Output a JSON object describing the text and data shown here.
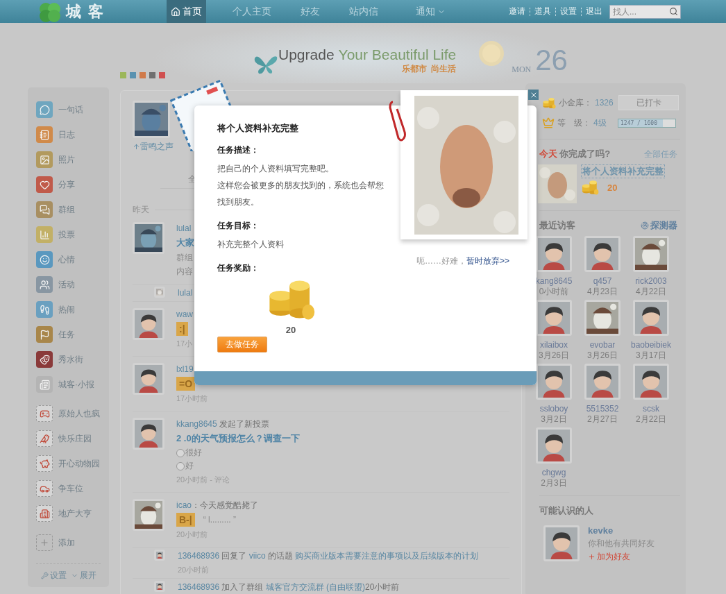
{
  "nav": {
    "logo": "城客",
    "tabs": [
      {
        "label": "首页",
        "kind": "home",
        "selected": true
      },
      {
        "label": "个人主页",
        "kind": "link",
        "selected": false
      },
      {
        "label": "好友",
        "kind": "link",
        "selected": false
      },
      {
        "label": "站内信",
        "kind": "link",
        "selected": false
      },
      {
        "label": "通知",
        "kind": "menu",
        "selected": false
      }
    ],
    "links": [
      "邀请",
      "道具",
      "设置",
      "退出"
    ],
    "search": {
      "placeholder": "找人..."
    }
  },
  "banner": {
    "word": "Upgrade",
    "slogan": "Your Beautiful Life",
    "tagline": "乐都市  尚生活",
    "weekday": "MON",
    "day": "26",
    "skins": [
      {
        "color": "#9cb75a"
      },
      {
        "color": "#5a92b0"
      },
      {
        "color": "#d07a4a"
      },
      {
        "color": "#6f6f6f"
      },
      {
        "color": "#d05050"
      }
    ]
  },
  "sidebar": {
    "items": [
      {
        "label": "一句话",
        "kind": "app"
      },
      {
        "label": "日志",
        "kind": "app"
      },
      {
        "label": "照片",
        "kind": "app"
      },
      {
        "label": "分享",
        "kind": "app"
      },
      {
        "label": "群组",
        "kind": "app"
      },
      {
        "label": "投票",
        "kind": "app"
      },
      {
        "label": "心情",
        "kind": "app"
      },
      {
        "label": "活动",
        "kind": "app"
      },
      {
        "label": "热闹",
        "kind": "app"
      },
      {
        "label": "任务",
        "kind": "app"
      },
      {
        "label": "秀水街",
        "kind": "app"
      },
      {
        "label": "城客·小报",
        "kind": "app"
      },
      {
        "label": "原始人也疯",
        "kind": "game"
      },
      {
        "label": "快乐庄园",
        "kind": "game"
      },
      {
        "label": "开心动物园",
        "kind": "game"
      },
      {
        "label": "争车位",
        "kind": "game"
      },
      {
        "label": "地产大亨",
        "kind": "game"
      },
      {
        "label": "添加",
        "kind": "add"
      }
    ],
    "settings": "设置",
    "expand": "展开"
  },
  "profile": {
    "name": "雷鸣之声"
  },
  "feed": {
    "tab": "全",
    "day": "昨天",
    "items": [
      {
        "kind": "post",
        "photo": true,
        "lines": [
          {
            "kind": "parts",
            "parts": [
              {
                "text": "lulal",
                "link": true
              }
            ]
          },
          {
            "kind": "title",
            "text": "大家"
          },
          {
            "kind": "text",
            "text": "群组"
          },
          {
            "kind": "text",
            "text": "内容"
          }
        ]
      },
      {
        "kind": "activity",
        "photo": true,
        "lines": [
          {
            "kind": "parts",
            "parts": [
              {
                "text": "lulal",
                "link": true
              }
            ]
          }
        ]
      },
      {
        "kind": "post",
        "photo": false,
        "lines": [
          {
            "kind": "parts",
            "parts": [
              {
                "text": "waw",
                "link": true
              }
            ]
          },
          {
            "kind": "mood",
            "badge": ":|"
          },
          {
            "kind": "meta",
            "text": "17小"
          }
        ]
      },
      {
        "kind": "post",
        "photo": false,
        "lines": [
          {
            "kind": "parts",
            "parts": [
              {
                "text": "lxl19",
                "link": true
              }
            ]
          },
          {
            "kind": "mood",
            "badge": "=O"
          },
          {
            "kind": "meta",
            "text": "17小时前"
          }
        ]
      },
      {
        "kind": "post",
        "photo": false,
        "lines": [
          {
            "kind": "parts",
            "parts": [
              {
                "text": "kkang8645",
                "link": true
              },
              {
                "text": " 发起了新投票",
                "link": false
              }
            ]
          },
          {
            "kind": "title",
            "text": "2 .0的天气预报怎么？调查一下"
          },
          {
            "kind": "option",
            "text": "很好",
            "selected": false
          },
          {
            "kind": "option",
            "text": "好",
            "selected": false
          },
          {
            "kind": "meta",
            "text": "20小时前 - 评论"
          }
        ]
      },
      {
        "kind": "post",
        "photo": true,
        "lines": [
          {
            "kind": "parts",
            "parts": [
              {
                "text": "icao",
                "link": true
              },
              {
                "text": "：今天感觉酷毙了",
                "link": false
              }
            ]
          },
          {
            "kind": "mood",
            "badge": "B-|",
            "quote": "“ l......... ”"
          },
          {
            "kind": "meta",
            "text": "20小时前"
          }
        ]
      },
      {
        "kind": "activity",
        "photo": false,
        "lines": [
          {
            "kind": "parts",
            "parts": [
              {
                "text": "136468936",
                "link": true
              },
              {
                "text": " 回复了 ",
                "link": false
              },
              {
                "text": "viico",
                "link": true
              },
              {
                "text": " 的话题 ",
                "link": false
              },
              {
                "text": "购买商业版本需要注意的事项以及后续版本的计划",
                "link": true
              }
            ]
          },
          {
            "kind": "meta",
            "text": "20小时前"
          }
        ]
      },
      {
        "kind": "activity",
        "photo": false,
        "lines": [
          {
            "kind": "parts",
            "parts": [
              {
                "text": "136468936",
                "link": true
              },
              {
                "text": " 加入了群组 ",
                "link": false
              },
              {
                "text": "城客官方交流群",
                "link": true
              },
              {
                "text": " (自由联盟)",
                "link": true
              },
              {
                "text": "20小时前",
                "link": false
              }
            ]
          }
        ]
      }
    ]
  },
  "stats": {
    "vault_label": "小金库：",
    "vault": "1326",
    "checkin": {
      "label": "已打卡",
      "disabled": true
    },
    "level_label": "等　级：",
    "level_value": "4级",
    "level": {
      "reading": "1247 / 1600",
      "level": 0.78
    }
  },
  "tasks": {
    "highlight": "今天",
    "title": "你完成了吗?",
    "all": "全部任务",
    "task": "将个人资料补充完整",
    "reward": "20"
  },
  "visitors": {
    "title": "最近访客",
    "tool": "探测器",
    "items": [
      {
        "name": "kang8645",
        "date": "0小时前",
        "photo": false
      },
      {
        "name": "q457",
        "date": "4月23日",
        "photo": false
      },
      {
        "name": "rick2003",
        "date": "4月22日",
        "photo": true
      },
      {
        "name": "xilaibox",
        "date": "3月26日",
        "photo": false
      },
      {
        "name": "evobar",
        "date": "3月26日",
        "photo": true
      },
      {
        "name": "baobeibiek",
        "date": "3月17日",
        "photo": false
      },
      {
        "name": "ssloboy",
        "date": "3月2日",
        "photo": false
      },
      {
        "name": "5515352",
        "date": "2月27日",
        "photo": false
      },
      {
        "name": "scsk",
        "date": "2月22日",
        "photo": false
      },
      {
        "name": "chgwg",
        "date": "2月3日",
        "photo": false
      }
    ]
  },
  "suggest": {
    "title": "可能认识的人",
    "people": [
      {
        "name": "kevke",
        "note": "你和他有共同好友",
        "action": "加为好友"
      }
    ]
  },
  "modal": {
    "title": "将个人资料补充完整",
    "sections": [
      {
        "heading": "任务描述：",
        "lines": [
          "把自己的个人资料填写完整吧。",
          "这样您会被更多的朋友找到的，系统也会帮您找到朋友。"
        ]
      },
      {
        "heading": "任务目标：",
        "lines": [
          "补充完整个人资料"
        ]
      },
      {
        "heading": "任务奖励：",
        "reward": "20"
      }
    ],
    "button": "去做任务",
    "aside": "呃……好难，",
    "giveup": "暂时放弃>>"
  }
}
